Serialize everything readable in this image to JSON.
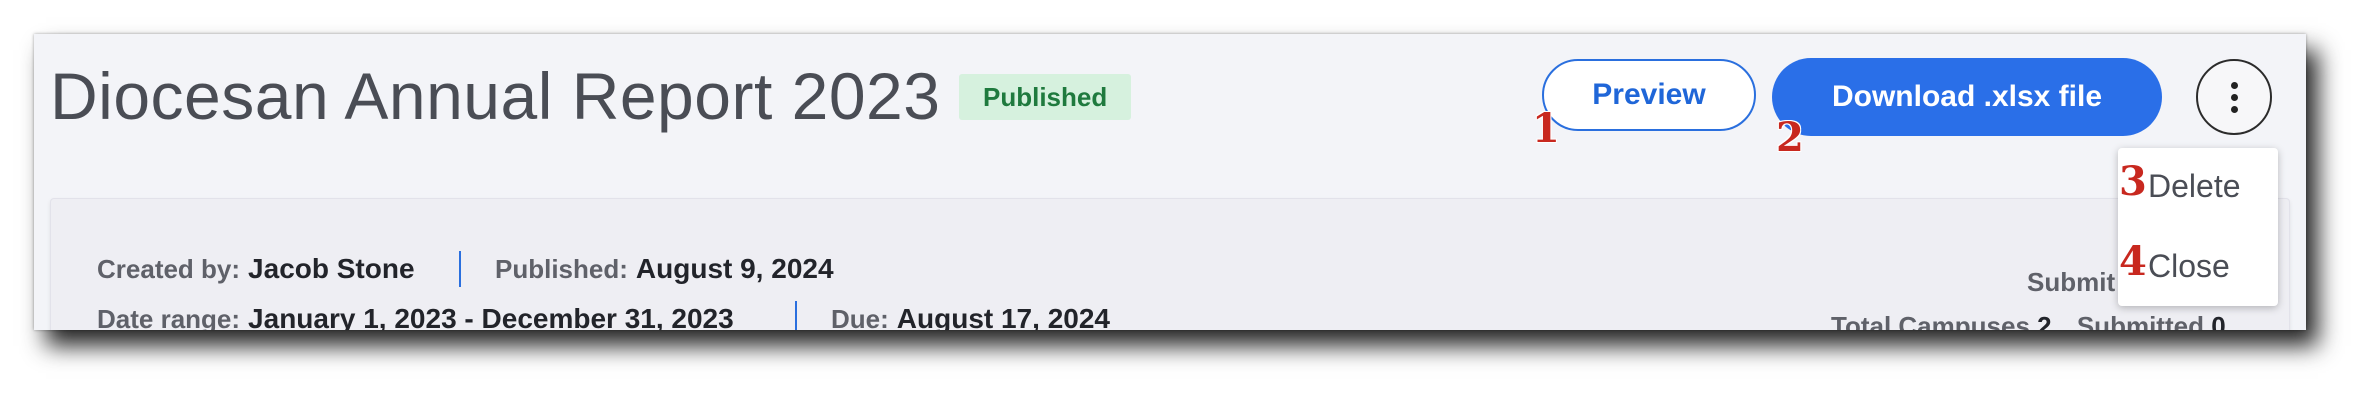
{
  "report": {
    "title": "Diocesan Annual Report 2023",
    "status_badge": "Published"
  },
  "actions": {
    "preview_label": "Preview",
    "download_label": "Download .xlsx file",
    "more_icon": "more-vertical-icon"
  },
  "menu": {
    "items": [
      {
        "label": "Delete",
        "marker": "3"
      },
      {
        "label": "Close",
        "marker": "4"
      }
    ]
  },
  "markers": {
    "preview": "1",
    "download": "2"
  },
  "details": {
    "created_by_label": "Created by:",
    "created_by_value": "Jacob Stone",
    "published_label": "Published:",
    "published_value": "August 9, 2024",
    "date_range_label": "Date range:",
    "date_range_value": "January 1, 2023 - December 31, 2023",
    "due_label": "Due:",
    "due_value": "August 17, 2024"
  },
  "summary": {
    "submit_partial": "Submit",
    "total_campuses_label": "Total Campuses",
    "total_campuses_value": "2",
    "submitted_label": "Submitted",
    "submitted_value": "0"
  },
  "colors": {
    "accent": "#2a6fe8",
    "badge_bg": "#d6f1de",
    "badge_text": "#1f7a3e",
    "marker": "#c8281f"
  }
}
